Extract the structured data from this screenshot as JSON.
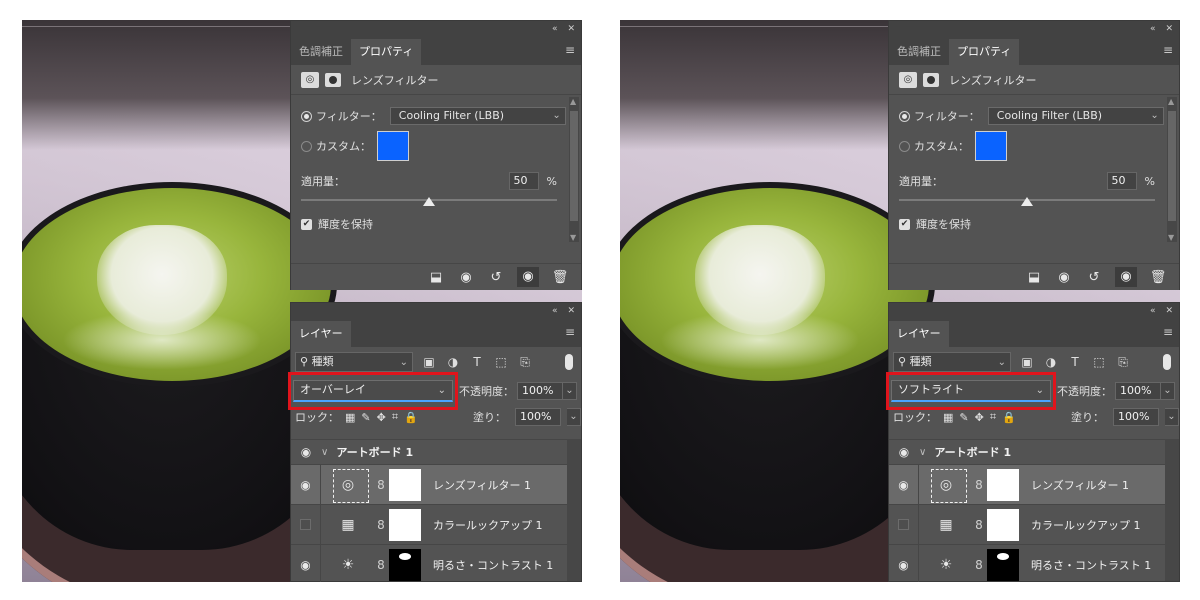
{
  "panes": [
    {
      "properties": {
        "tabs": [
          "色調補正",
          "プロパティ"
        ],
        "active_tab": 1,
        "title": "レンズフィルター",
        "filter_label": "フィルター：",
        "filter_value": "Cooling Filter (LBB)",
        "custom_label": "カスタム：",
        "custom_color": "#0a63ff",
        "density_label": "適用量：",
        "density_value": "50",
        "density_unit": "%",
        "density_fraction": 0.5,
        "preserve_label": "輝度を保持"
      },
      "layers": {
        "tab": "レイヤー",
        "kind_filter": "種類",
        "blend_mode": "オーバーレイ",
        "opacity_label": "不透明度：",
        "opacity_value": "100%",
        "lock_label": "ロック：",
        "fill_label": "塗り：",
        "fill_value": "100%",
        "group_name": "アートボード 1",
        "items": [
          {
            "name": "レンズフィルター 1",
            "icon": "camera-filter-icon",
            "visible": true,
            "selected": true
          },
          {
            "name": "カラールックアップ 1",
            "icon": "grid-lookup-icon",
            "visible": false,
            "selected": false
          },
          {
            "name": "明るさ・コントラスト 1",
            "icon": "sun-brightness-icon",
            "visible": true,
            "selected": false
          }
        ]
      }
    },
    {
      "properties": {
        "tabs": [
          "色調補正",
          "プロパティ"
        ],
        "active_tab": 1,
        "title": "レンズフィルター",
        "filter_label": "フィルター：",
        "filter_value": "Cooling Filter (LBB)",
        "custom_label": "カスタム：",
        "custom_color": "#0a63ff",
        "density_label": "適用量：",
        "density_value": "50",
        "density_unit": "%",
        "density_fraction": 0.5,
        "preserve_label": "輝度を保持"
      },
      "layers": {
        "tab": "レイヤー",
        "kind_filter": "種類",
        "blend_mode": "ソフトライト",
        "opacity_label": "不透明度：",
        "opacity_value": "100%",
        "lock_label": "ロック：",
        "fill_label": "塗り：",
        "fill_value": "100%",
        "group_name": "アートボード 1",
        "items": [
          {
            "name": "レンズフィルター 1",
            "icon": "camera-filter-icon",
            "visible": true,
            "selected": true
          },
          {
            "name": "カラールックアップ 1",
            "icon": "grid-lookup-icon",
            "visible": false,
            "selected": false
          },
          {
            "name": "明るさ・コントラスト 1",
            "icon": "sun-brightness-icon",
            "visible": true,
            "selected": false
          }
        ]
      }
    }
  ],
  "colors": {
    "highlight": "#e0141c",
    "panel_bg": "#535353",
    "panel_dark": "#424242"
  }
}
